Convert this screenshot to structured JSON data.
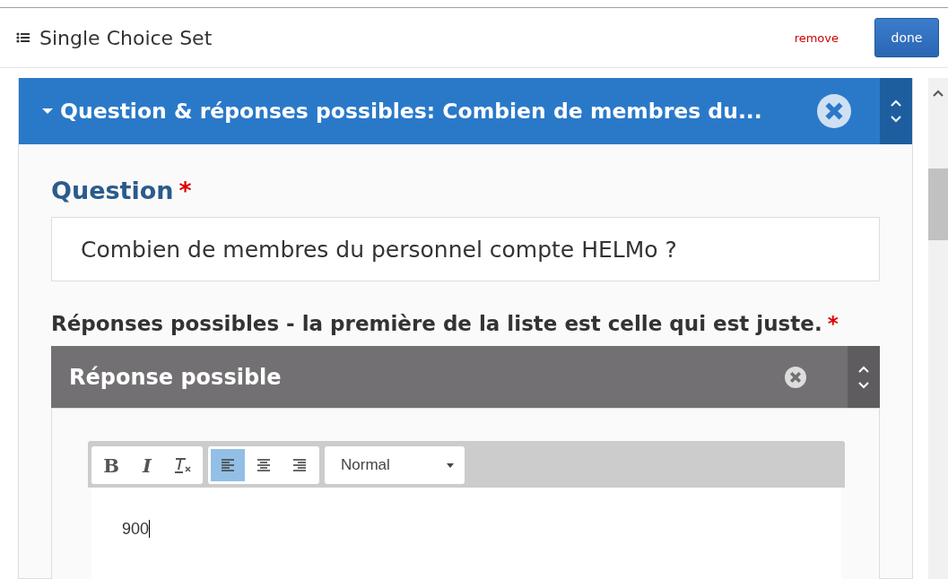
{
  "header": {
    "title": "Single Choice Set",
    "remove": "remove",
    "done": "done"
  },
  "group": {
    "title": "Question & réponses possibles: Combien de membres du...",
    "expanded": true,
    "question": {
      "label": "Question",
      "required": "*",
      "value": "Combien de membres du personnel compte HELMo ?"
    },
    "answers": {
      "label": "Réponses possibles - la première de la liste est celle qui est juste.",
      "required": "*",
      "items": [
        {
          "title": "Réponse possible",
          "format_buttons": [
            {
              "kind": "bold",
              "label": "B"
            },
            {
              "kind": "italic",
              "label": "I"
            },
            {
              "kind": "clear"
            }
          ],
          "align_buttons": [
            {
              "kind": "left",
              "selected": true
            },
            {
              "kind": "center",
              "selected": false
            },
            {
              "kind": "right",
              "selected": false
            }
          ],
          "format_select": "Normal",
          "text": "900"
        }
      ]
    }
  }
}
